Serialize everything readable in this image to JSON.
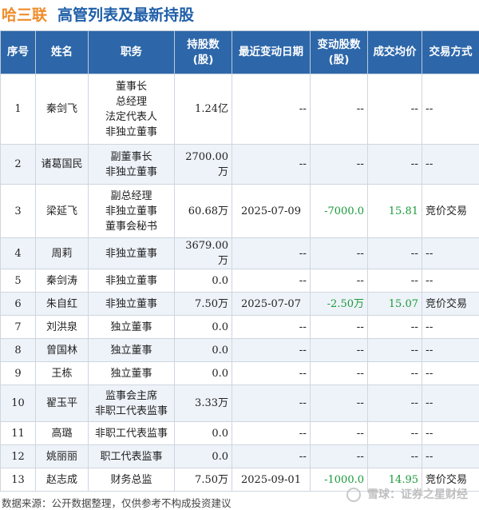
{
  "title": {
    "company": "哈三联",
    "heading": "高管列表及最新持股"
  },
  "table": {
    "headers": {
      "idx": "序号",
      "name": "姓名",
      "role": "职务",
      "shares": [
        "持股数",
        "(股)"
      ],
      "date": "最近变动日期",
      "change": [
        "变动股数",
        "(股)"
      ],
      "price": "成交均价",
      "mode": "交易方式"
    },
    "rows": [
      {
        "idx": "1",
        "name": "秦剑飞",
        "roles": [
          "董事长",
          "总经理",
          "法定代表人",
          "非独立董事"
        ],
        "shares": "1.24亿",
        "date": "--",
        "change": "--",
        "price": "--",
        "mode": "--"
      },
      {
        "idx": "2",
        "name": "诸葛国民",
        "roles": [
          "副董事长",
          "非独立董事"
        ],
        "shares": "2700.00万",
        "date": "--",
        "change": "--",
        "price": "--",
        "mode": "--"
      },
      {
        "idx": "3",
        "name": "梁延飞",
        "roles": [
          "副总经理",
          "非独立董事",
          "董事会秘书"
        ],
        "shares": "60.68万",
        "date": "2025-07-09",
        "change": "-7000.0",
        "price": "15.81",
        "mode": "竞价交易"
      },
      {
        "idx": "4",
        "name": "周莉",
        "roles": [
          "非独立董事"
        ],
        "shares": "3679.00万",
        "date": "--",
        "change": "--",
        "price": "--",
        "mode": "--"
      },
      {
        "idx": "5",
        "name": "秦剑涛",
        "roles": [
          "非独立董事"
        ],
        "shares": "0.0",
        "date": "--",
        "change": "--",
        "price": "--",
        "mode": "--"
      },
      {
        "idx": "6",
        "name": "朱自红",
        "roles": [
          "非独立董事"
        ],
        "shares": "7.50万",
        "date": "2025-07-07",
        "change": "-2.50万",
        "price": "15.07",
        "mode": "竞价交易"
      },
      {
        "idx": "7",
        "name": "刘洪泉",
        "roles": [
          "独立董事"
        ],
        "shares": "0.0",
        "date": "--",
        "change": "--",
        "price": "--",
        "mode": "--"
      },
      {
        "idx": "8",
        "name": "曾国林",
        "roles": [
          "独立董事"
        ],
        "shares": "0.0",
        "date": "--",
        "change": "--",
        "price": "--",
        "mode": "--"
      },
      {
        "idx": "9",
        "name": "王栋",
        "roles": [
          "独立董事"
        ],
        "shares": "0.0",
        "date": "--",
        "change": "--",
        "price": "--",
        "mode": "--"
      },
      {
        "idx": "10",
        "name": "翟玉平",
        "roles": [
          "监事会主席",
          "非职工代表监事"
        ],
        "shares": "3.33万",
        "date": "--",
        "change": "--",
        "price": "--",
        "mode": "--"
      },
      {
        "idx": "11",
        "name": "高璐",
        "roles": [
          "非职工代表监事"
        ],
        "shares": "0.0",
        "date": "--",
        "change": "--",
        "price": "--",
        "mode": "--"
      },
      {
        "idx": "12",
        "name": "姚丽丽",
        "roles": [
          "职工代表监事"
        ],
        "shares": "0.0",
        "date": "--",
        "change": "--",
        "price": "--",
        "mode": "--"
      },
      {
        "idx": "13",
        "name": "赵志成",
        "roles": [
          "财务总监"
        ],
        "shares": "7.50万",
        "date": "2025-09-01",
        "change": "-1000.0",
        "price": "14.95",
        "mode": "竞价交易"
      }
    ]
  },
  "footer": {
    "source": "数据来源：公开数据整理，仅供参考不构成投资建议",
    "brand": "雪球：证券之星财经"
  },
  "watermark_text": "证券之星",
  "colors": {
    "company": "#f08c2a",
    "heading": "#1f5fa8",
    "header_bg": "#2d67a9",
    "positive_change": "#1a9a3a"
  }
}
